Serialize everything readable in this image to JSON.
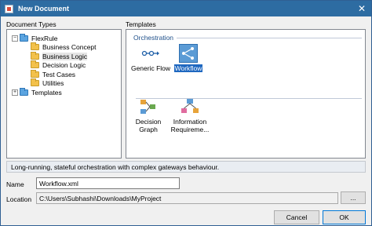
{
  "window": {
    "title": "New Document",
    "close_glyph": "✕"
  },
  "left_panel": {
    "label": "Document Types",
    "tree": [
      {
        "label": "FlexRule",
        "expander": "−",
        "level": 0,
        "icon": "folder-blue-icon"
      },
      {
        "label": "Business Concept",
        "level": 1
      },
      {
        "label": "Business Logic",
        "level": 1,
        "selected": true
      },
      {
        "label": "Decision Logic",
        "level": 1
      },
      {
        "label": "Test Cases",
        "level": 1
      },
      {
        "label": "Utilities",
        "level": 1
      },
      {
        "label": "Templates",
        "expander": "+",
        "level": 0,
        "icon": "folder-blue-icon"
      }
    ]
  },
  "right_panel": {
    "label": "Templates",
    "group": "Orchestration",
    "templates": [
      {
        "label": "Generic Flow",
        "selected": false
      },
      {
        "label": "Workflow",
        "selected": true
      },
      {
        "label": "Decision Graph",
        "line1": "Decision",
        "line2": "Graph",
        "selected": false
      },
      {
        "label": "Information Requirements",
        "line1": "Information",
        "line2": "Requireme...",
        "selected": false
      }
    ]
  },
  "description": "Long-running, stateful orchestration with complex gateways behaviour.",
  "form": {
    "name_label": "Name",
    "name_value": "Workflow.xml",
    "location_label": "Location",
    "location_value": "C:\\Users\\Subhashi\\Downloads\\MyProject",
    "browse_label": "..."
  },
  "buttons": {
    "cancel": "Cancel",
    "ok": "OK"
  },
  "colors": {
    "titlebar": "#2d6ca2",
    "selection": "#1f68c0",
    "accent_border": "#0078d7"
  }
}
